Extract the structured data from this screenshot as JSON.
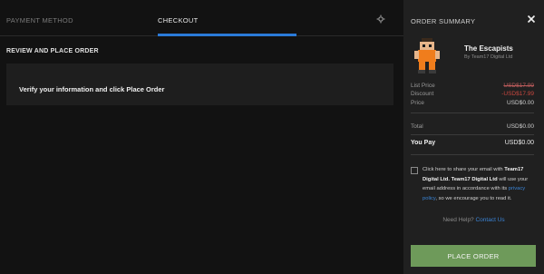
{
  "tabs": {
    "payment_label": "PAYMENT METHOD",
    "checkout_label": "CHECKOUT",
    "active_color": "#2a7ad8",
    "icon": "settings-icon"
  },
  "main": {
    "section_title": "REVIEW AND PLACE ORDER",
    "review_message": "Verify your information and click Place Order"
  },
  "summary": {
    "title": "ORDER SUMMARY",
    "close_icon": "close-icon",
    "game": {
      "title": "The Escapists",
      "publisher": "By Team17 Digital Ltd"
    },
    "list_price_label": "List Price",
    "list_price_value": "USD$17.99",
    "discount_label": "Discount",
    "discount_value": "-USD$17.99",
    "price_label": "Price",
    "price_value": "USD$0.00",
    "total_label": "Total",
    "total_value": "USD$0.00",
    "you_pay_label": "You Pay",
    "you_pay_value": "USD$0.00"
  },
  "consent": {
    "text1": "Click here to share your email with",
    "company1": "Team17 Digital Ltd.",
    "company2": "Team17 Digital Ltd",
    "text2": "will use your email address in accordance with its",
    "privacy_link": "privacy policy",
    "text3": ", so we encourage you to read it."
  },
  "help": {
    "prefix": "Need Help?",
    "link": "Contact Us"
  },
  "place_order_label": "PLACE ORDER",
  "colors": {
    "accent": "#2a7ad8",
    "button": "#6e9a5a",
    "discount": "#c9473f"
  }
}
